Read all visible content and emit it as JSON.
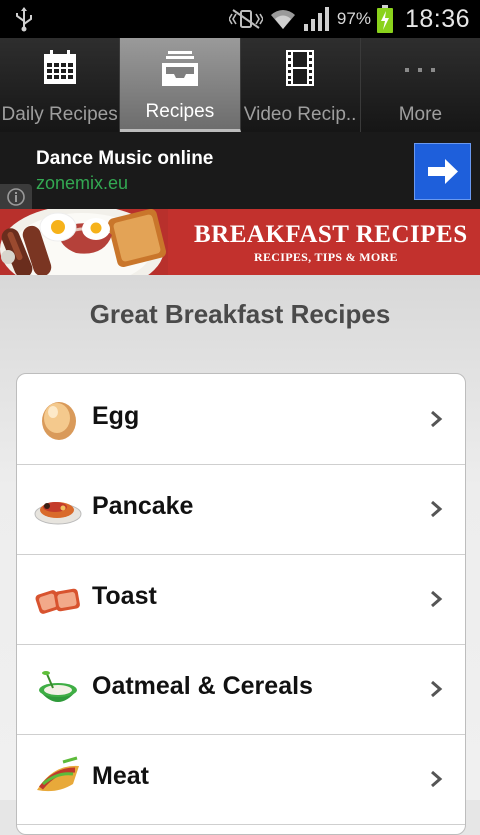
{
  "status_bar": {
    "battery_percent": "97%",
    "time": "18:36"
  },
  "tabs": [
    {
      "label": "Daily Recipes",
      "icon": "calendar-icon",
      "active": false
    },
    {
      "label": "Recipes",
      "icon": "inbox-tray-icon",
      "active": true
    },
    {
      "label": "Video Recip..",
      "icon": "film-icon",
      "active": false
    },
    {
      "label": "More",
      "icon": "more-dots-icon",
      "active": false
    }
  ],
  "ad": {
    "title": "Dance Music online",
    "domain": "zonemix.eu",
    "accent": "#1e5fdb"
  },
  "banner": {
    "title": "BREAKFAST RECIPES",
    "subtitle": "RECIPES, TIPS & MORE",
    "color": "#c2312d"
  },
  "page": {
    "heading": "Great Breakfast Recipes"
  },
  "categories": [
    {
      "label": "Egg",
      "icon": "egg-icon"
    },
    {
      "label": "Pancake",
      "icon": "pancake-icon"
    },
    {
      "label": "Toast",
      "icon": "toast-icon"
    },
    {
      "label": "Oatmeal & Cereals",
      "icon": "oatmeal-bowl-icon"
    },
    {
      "label": "Meat",
      "icon": "meat-wrap-icon"
    }
  ]
}
